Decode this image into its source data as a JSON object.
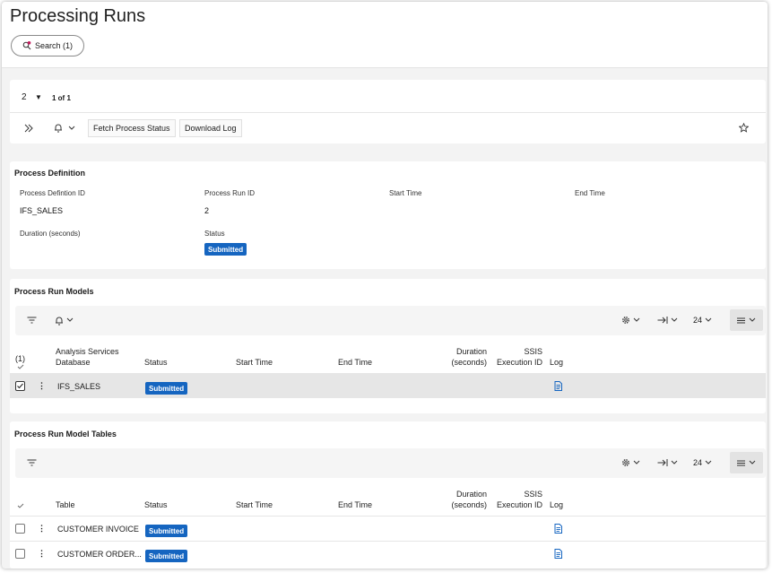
{
  "page": {
    "title": "Processing Runs"
  },
  "search": {
    "label": "Search (1)"
  },
  "navigator": {
    "record": "2",
    "of_label": "1 of 1"
  },
  "toolbar": {
    "fetch_label": "Fetch Process Status",
    "download_label": "Download Log"
  },
  "definition": {
    "title": "Process Definition",
    "fields": {
      "def_id_label": "Process Defintion ID",
      "def_id_value": "IFS_SALES",
      "run_id_label": "Process Run ID",
      "run_id_value": "2",
      "start_label": "Start Time",
      "end_label": "End Time",
      "duration_label": "Duration (seconds)",
      "status_label": "Status",
      "status_value": "Submitted"
    }
  },
  "models": {
    "title": "Process Run Models",
    "toolbar": {
      "page_size": "24"
    },
    "selected_count": "(1)",
    "columns": {
      "db1": "Analysis Services",
      "db2": "Database",
      "status": "Status",
      "start": "Start Time",
      "end": "End Time",
      "dur1": "Duration",
      "dur2": "(seconds)",
      "ssis1": "SSIS",
      "ssis2": "Execution ID",
      "log": "Log"
    },
    "rows": [
      {
        "database": "IFS_SALES",
        "status": "Submitted"
      }
    ]
  },
  "tables": {
    "title": "Process Run Model Tables",
    "toolbar": {
      "page_size": "24"
    },
    "columns": {
      "table": "Table",
      "status": "Status",
      "start": "Start Time",
      "end": "End Time",
      "dur1": "Duration",
      "dur2": "(seconds)",
      "ssis1": "SSIS",
      "ssis2": "Execution ID",
      "log": "Log"
    },
    "rows": [
      {
        "table": "CUSTOMER INVOICE",
        "status": "Submitted"
      },
      {
        "table": "CUSTOMER ORDER...",
        "status": "Submitted"
      }
    ]
  },
  "colors": {
    "badge": "#1565c0",
    "search_dot": "#c2185b",
    "log_icon": "#1565c0"
  },
  "icons": [
    "search-icon",
    "caret-down-icon",
    "expand-icon",
    "bell-icon",
    "chevron-down-icon",
    "star-icon",
    "filter-icon",
    "settings-icon",
    "arrow-right-bar-icon",
    "list-view-icon",
    "checkmark-icon",
    "more-vert-icon",
    "log-document-icon"
  ]
}
